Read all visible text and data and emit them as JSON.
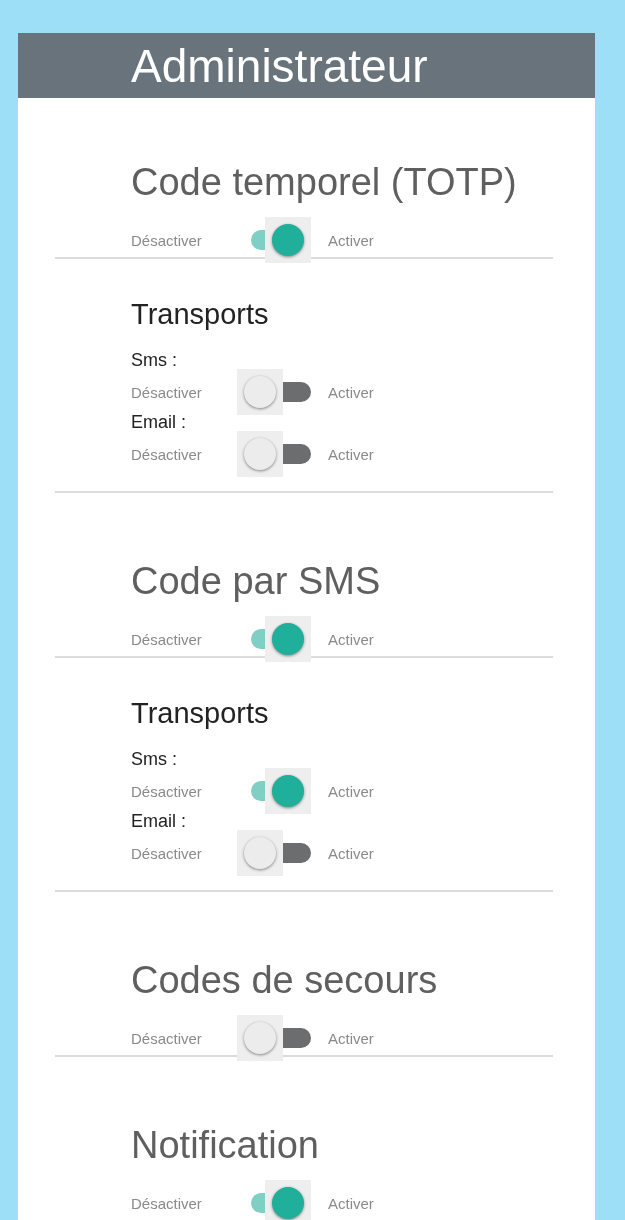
{
  "header": {
    "title": "Administrateur"
  },
  "sections": [
    {
      "title": "Code temporel (TOTP)",
      "off_label": "Désactiver",
      "on_label": "Activer",
      "on": true,
      "transports": {
        "heading": "Transports",
        "items": [
          {
            "label": "Sms :",
            "off_label": "Désactiver",
            "on_label": "Activer",
            "on": false
          },
          {
            "label": "Email :",
            "off_label": "Désactiver",
            "on_label": "Activer",
            "on": false
          }
        ]
      }
    },
    {
      "title": "Code par SMS",
      "off_label": "Désactiver",
      "on_label": "Activer",
      "on": true,
      "transports": {
        "heading": "Transports",
        "items": [
          {
            "label": "Sms :",
            "off_label": "Désactiver",
            "on_label": "Activer",
            "on": true
          },
          {
            "label": "Email :",
            "off_label": "Désactiver",
            "on_label": "Activer",
            "on": false
          }
        ]
      }
    },
    {
      "title": "Codes de secours",
      "off_label": "Désactiver",
      "on_label": "Activer",
      "on": false
    },
    {
      "title": "Notification",
      "off_label": "Désactiver",
      "on_label": "Activer",
      "on": true
    }
  ]
}
